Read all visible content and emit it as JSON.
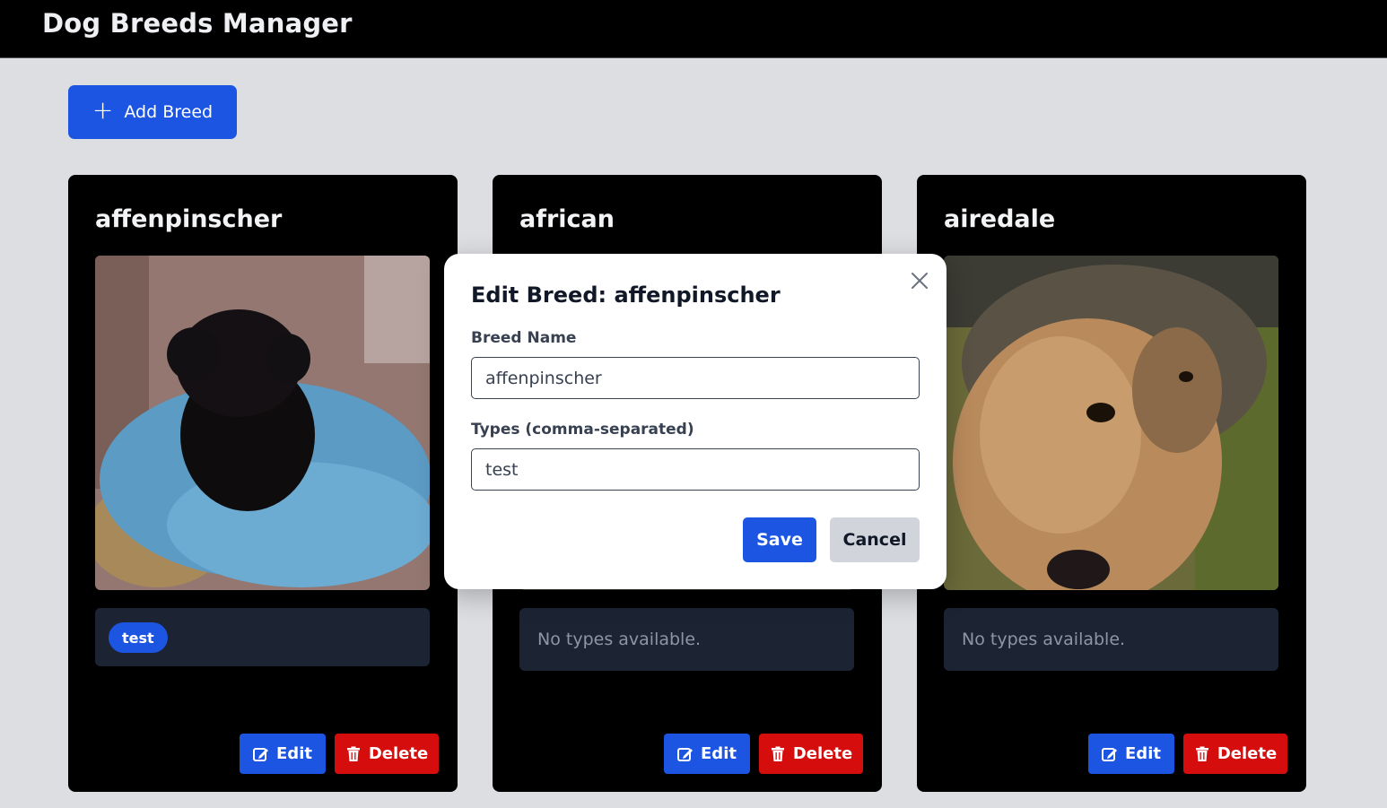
{
  "header": {
    "title": "Dog Breeds Manager"
  },
  "toolbar": {
    "add_label": "Add Breed"
  },
  "cards": [
    {
      "title": "affenpinscher",
      "tags": [
        "test"
      ],
      "empty_text": "",
      "edit_label": "Edit",
      "delete_label": "Delete"
    },
    {
      "title": "african",
      "tags": [],
      "empty_text": "No types available.",
      "edit_label": "Edit",
      "delete_label": "Delete"
    },
    {
      "title": "airedale",
      "tags": [],
      "empty_text": "No types available.",
      "edit_label": "Edit",
      "delete_label": "Delete"
    }
  ],
  "modal": {
    "title": "Edit Breed: affenpinscher",
    "name_label": "Breed Name",
    "name_value": "affenpinscher",
    "types_label": "Types (comma-separated)",
    "types_value": "test",
    "save_label": "Save",
    "cancel_label": "Cancel"
  },
  "colors": {
    "primary": "#1d55e3",
    "danger": "#d60d0d",
    "card_bg": "#000000",
    "types_bg": "#1c2434",
    "page_bg": "#dcdee2"
  },
  "icons": [
    "plus-icon",
    "edit-icon",
    "trash-icon",
    "close-icon"
  ]
}
